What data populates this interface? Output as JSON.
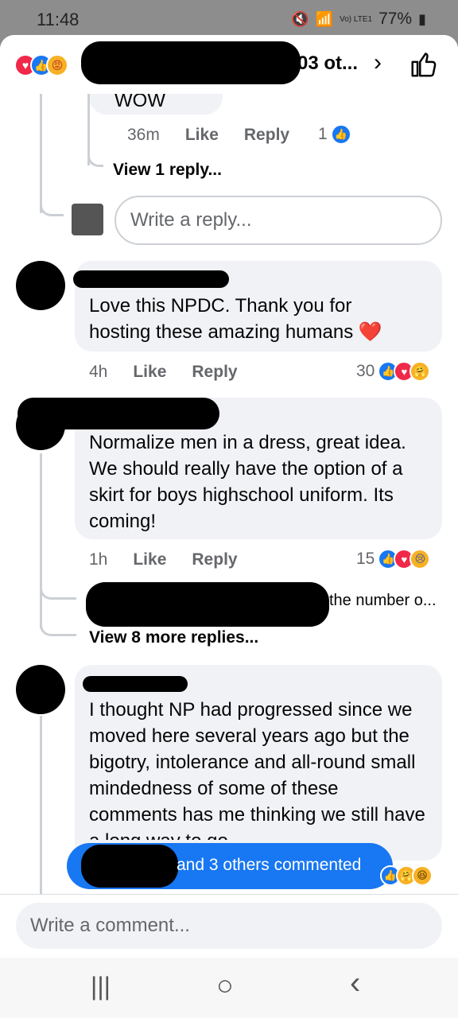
{
  "status_bar": {
    "time": "11:48",
    "signal_label": "Vo) LTE1",
    "battery": "77%"
  },
  "header": {
    "title_suffix": "03 ot...",
    "chevron": "›"
  },
  "thread_top": {
    "partial_text": "wow",
    "time": "36m",
    "like_label": "Like",
    "reply_label": "Reply",
    "reaction_count": "1",
    "view_replies": "View 1 reply...",
    "reply_placeholder": "Write a reply..."
  },
  "comments": [
    {
      "text": "Love this NPDC. Thank you for hosting these amazing humans ❤️",
      "time": "4h",
      "like_label": "Like",
      "reply_label": "Reply",
      "reaction_count": "30"
    },
    {
      "text": "Normalize men in a dress, great idea. We should really have the option of a skirt for boys highschool uniform. Its coming!",
      "time": "1h",
      "like_label": "Like",
      "reply_label": "Reply",
      "reaction_count": "15",
      "reply_preview": "the number o...",
      "view_more": "View 8 more replies..."
    },
    {
      "text": "I thought NP had progressed since we moved here several years ago but the bigotry, intolerance and all-round small mindedness of some of these comments has me thinking we still have a long way to go"
    }
  ],
  "toast": {
    "text": "and 3 others commented"
  },
  "composer": {
    "placeholder": "Write a comment..."
  },
  "nav": {
    "recents": "|||",
    "home": "○",
    "back": "‹"
  },
  "colors": {
    "accent": "#1877f2",
    "love": "#f02849",
    "bubble": "#f0f2f5"
  }
}
